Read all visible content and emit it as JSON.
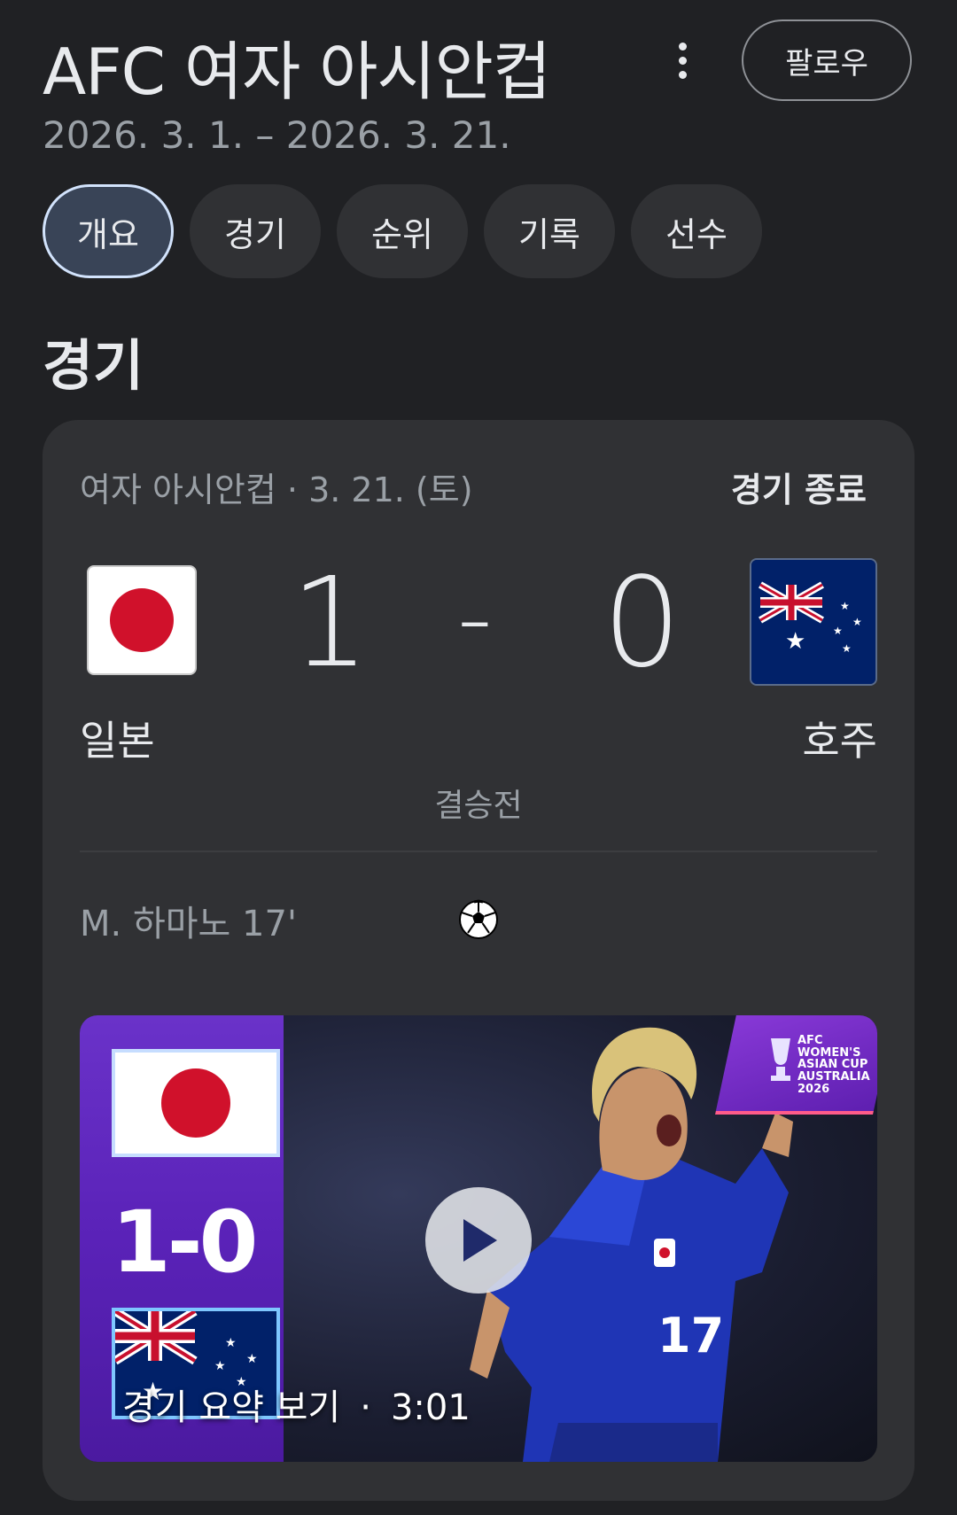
{
  "header": {
    "title": "AFC 여자 아시안컵",
    "date_range": "2026. 3. 1. – 2026. 3. 21.",
    "follow_label": "팔로우"
  },
  "tabs": [
    {
      "label": "개요",
      "active": true
    },
    {
      "label": "경기",
      "active": false
    },
    {
      "label": "순위",
      "active": false
    },
    {
      "label": "기록",
      "active": false
    },
    {
      "label": "선수",
      "active": false
    }
  ],
  "section": {
    "title": "경기"
  },
  "match": {
    "meta": "여자 아시안컵 · 3. 21. (토)",
    "status": "경기 종료",
    "home": {
      "name": "일본",
      "score": "1",
      "flag": "japan-flag"
    },
    "away": {
      "name": "호주",
      "score": "0",
      "flag": "australia-flag"
    },
    "separator": "-",
    "stage": "결승전",
    "scorer": "M. 하마노 17'"
  },
  "video": {
    "caption": "경기 요약 보기",
    "duration": "3:01",
    "overlay_score": "1-0",
    "badge_text": "AFC WOMEN'S ASIAN CUP AUSTRALIA 2026"
  },
  "colors": {
    "background": "#202124",
    "card": "#303134",
    "active_tab": "#394457",
    "japan_red": "#d0112b",
    "australia_blue": "#012169",
    "video_purple": "#5a22b8"
  }
}
